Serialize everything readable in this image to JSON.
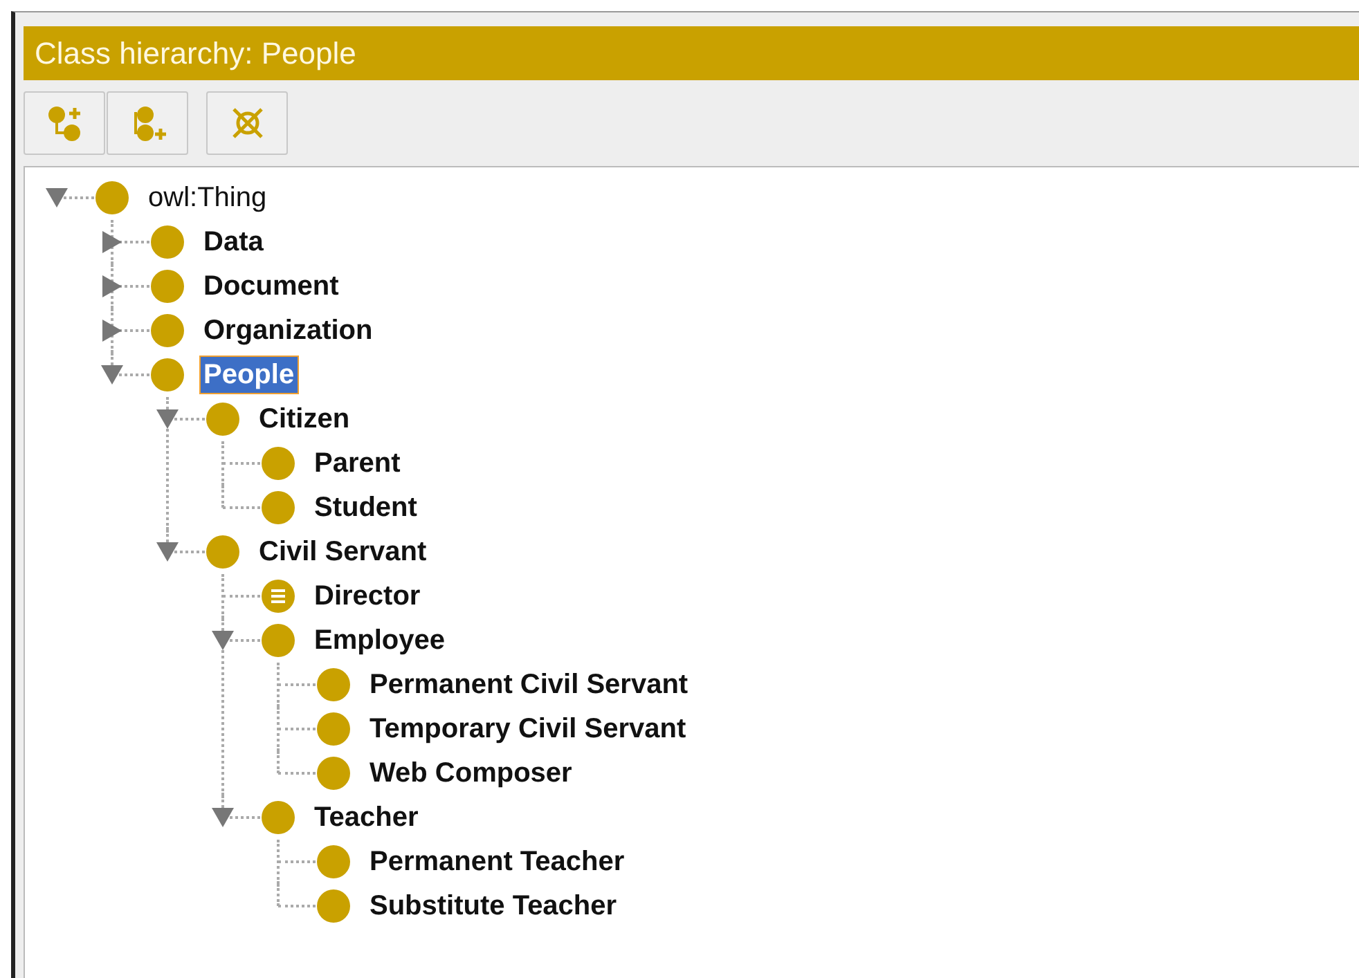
{
  "panel": {
    "title": "Class hierarchy: People"
  },
  "toolbar": [
    {
      "kind": "add-subclass"
    },
    {
      "kind": "add-sibling"
    },
    {
      "kind": "delete"
    }
  ],
  "tree": [
    {
      "label": "owl:Thing",
      "kind": "class",
      "bold": false,
      "selected": false,
      "expanded": true,
      "children": [
        {
          "label": "Data",
          "kind": "class",
          "bold": true,
          "selected": false,
          "expanded": false
        },
        {
          "label": "Document",
          "kind": "class",
          "bold": true,
          "selected": false,
          "expanded": false
        },
        {
          "label": "Organization",
          "kind": "class",
          "bold": true,
          "selected": false,
          "expanded": false
        },
        {
          "label": "People",
          "kind": "class",
          "bold": true,
          "selected": true,
          "expanded": true,
          "children": [
            {
              "label": "Citizen",
              "kind": "class",
              "bold": true,
              "selected": false,
              "expanded": true,
              "children": [
                {
                  "label": "Parent",
                  "kind": "class",
                  "bold": true,
                  "selected": false
                },
                {
                  "label": "Student",
                  "kind": "class",
                  "bold": true,
                  "selected": false
                }
              ]
            },
            {
              "label": "Civil Servant",
              "kind": "class",
              "bold": true,
              "selected": false,
              "expanded": true,
              "children": [
                {
                  "label": "Director",
                  "kind": "defined",
                  "bold": true,
                  "selected": false
                },
                {
                  "label": "Employee",
                  "kind": "class",
                  "bold": true,
                  "selected": false,
                  "expanded": true,
                  "children": [
                    {
                      "label": "Permanent Civil Servant",
                      "kind": "class",
                      "bold": true,
                      "selected": false
                    },
                    {
                      "label": "Temporary Civil Servant",
                      "kind": "class",
                      "bold": true,
                      "selected": false
                    },
                    {
                      "label": "Web Composer",
                      "kind": "class",
                      "bold": true,
                      "selected": false
                    }
                  ]
                },
                {
                  "label": "Teacher",
                  "kind": "class",
                  "bold": true,
                  "selected": false,
                  "expanded": true,
                  "children": [
                    {
                      "label": "Permanent Teacher",
                      "kind": "class",
                      "bold": true,
                      "selected": false
                    },
                    {
                      "label": "Substitute Teacher",
                      "kind": "class",
                      "bold": true,
                      "selected": false
                    }
                  ]
                }
              ]
            }
          ]
        }
      ]
    }
  ]
}
